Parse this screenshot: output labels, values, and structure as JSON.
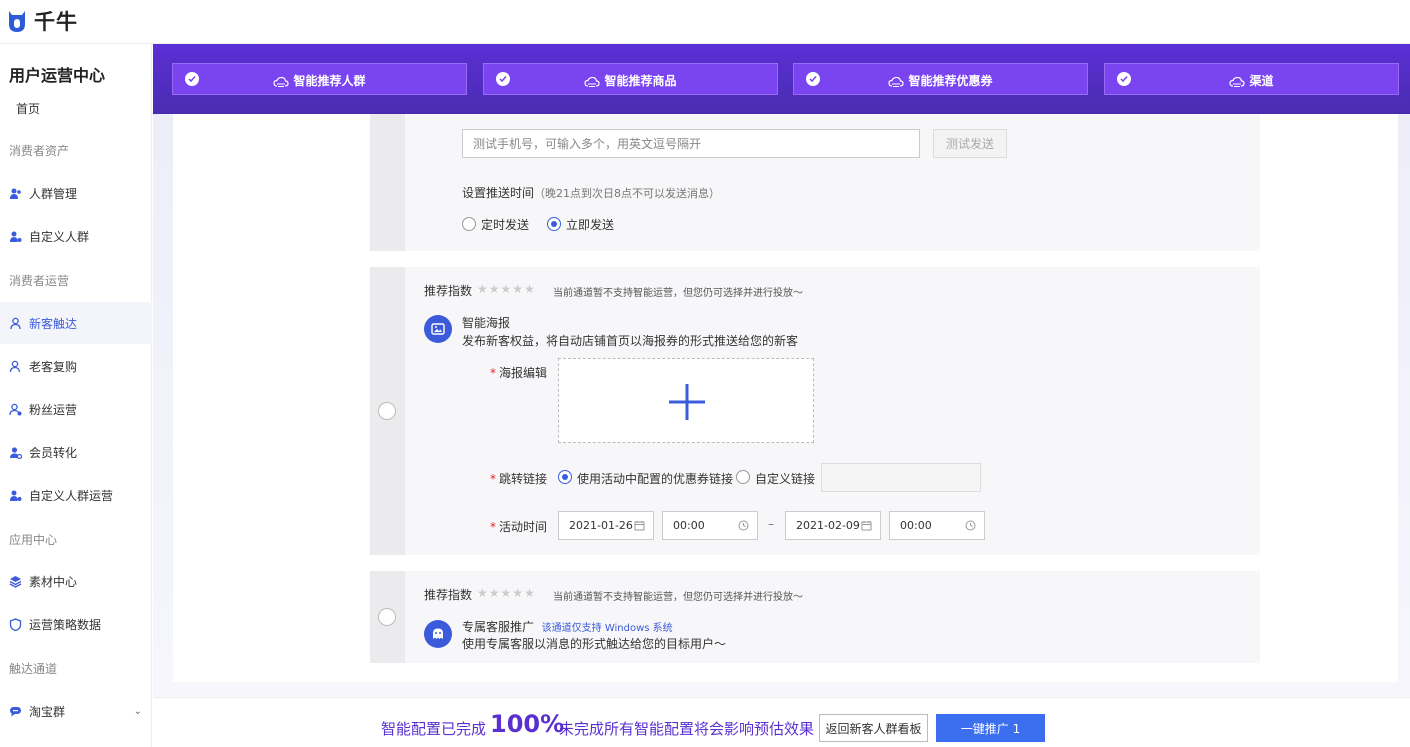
{
  "app": {
    "logo_text": "千牛"
  },
  "sidebar": {
    "title": "用户运营中心",
    "home": "首页",
    "groups": [
      "消费者资产",
      "消费者运营",
      "应用中心",
      "触达通道"
    ],
    "items": [
      {
        "label": "人群管理"
      },
      {
        "label": "自定义人群"
      },
      {
        "label": "新客触达"
      },
      {
        "label": "老客复购"
      },
      {
        "label": "粉丝运营"
      },
      {
        "label": "会员转化"
      },
      {
        "label": "自定义人群运营"
      },
      {
        "label": "素材中心"
      },
      {
        "label": "运营策略数据"
      },
      {
        "label": "淘宝群"
      }
    ]
  },
  "steps": [
    {
      "label": "智能推荐人群"
    },
    {
      "label": "智能推荐商品"
    },
    {
      "label": "智能推荐优惠券"
    },
    {
      "label": "渠道"
    }
  ],
  "sms": {
    "phone_placeholder": "测试手机号，可输入多个，用英文逗号隔开",
    "test_send": "测试发送",
    "schedule_label": "设置推送时间",
    "schedule_hint": "（晚21点到次日8点不可以发送消息）",
    "opt_timed": "定时发送",
    "opt_now": "立即发送"
  },
  "poster": {
    "rec_label": "推荐指数",
    "rec_note": "当前通道暂不支持智能运营，但您仍可选择并进行投放～",
    "title": "智能海报",
    "desc": "发布新客权益，将自动店铺首页以海报券的形式推送给您的新客",
    "edit_label": "海报编辑",
    "link_label": "跳转链接",
    "link_opt1": "使用活动中配置的优惠券链接",
    "link_opt2": "自定义链接",
    "time_label": "活动时间",
    "start_date": "2021-01-26",
    "start_time": "00:00",
    "sep": "–",
    "end_date": "2021-02-09",
    "end_time": "00:00"
  },
  "service": {
    "rec_label": "推荐指数",
    "rec_note": "当前通道暂不支持智能运营，但您仍可选择并进行投放～",
    "title": "专属客服推广",
    "tag": "该通道仅支持 Windows 系统",
    "desc": "使用专属客服以消息的形式触达给您的目标用户～"
  },
  "footer": {
    "done_text": "智能配置已完成",
    "percent": "100%",
    "warn_text": "未完成所有智能配置将会影响预估效果",
    "back_btn": "返回新客人群看板",
    "promote_btn": "一键推广 1"
  }
}
